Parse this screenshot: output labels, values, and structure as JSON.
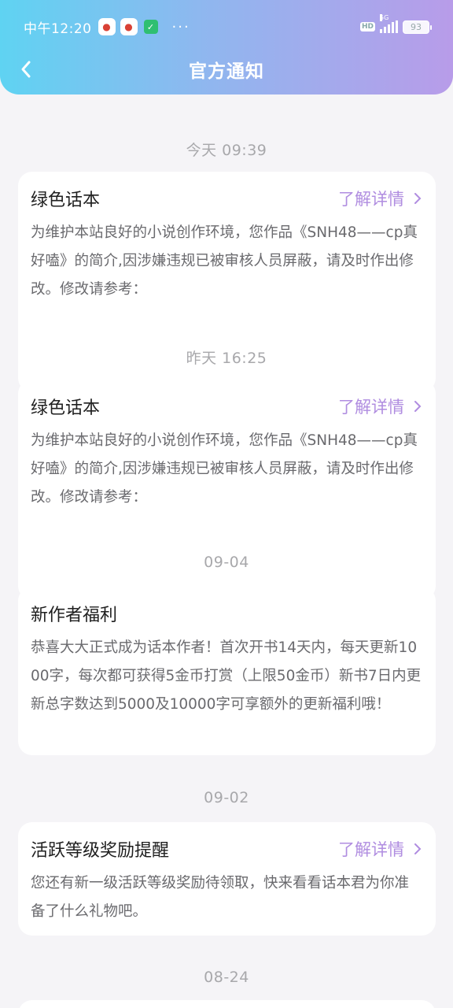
{
  "status_bar": {
    "time": "中午12:20",
    "network": "5G",
    "hd": "HD",
    "battery": "93"
  },
  "nav": {
    "title": "官方通知"
  },
  "notifications": [
    {
      "date": "今天 09:39",
      "title": "绿色话本",
      "link": "了解详情",
      "body": "为维护本站良好的小说创作环境，您作品《SNH48——cp真好嗑》的简介,因涉嫌违规已被审核人员屏蔽，请及时作出修改。修改请参考："
    },
    {
      "date": "昨天 16:25",
      "title": "绿色话本",
      "link": "了解详情",
      "body": "为维护本站良好的小说创作环境，您作品《SNH48——cp真好嗑》的简介,因涉嫌违规已被审核人员屏蔽，请及时作出修改。修改请参考："
    },
    {
      "date": "09-04",
      "title": "新作者福利",
      "link": "",
      "body": "恭喜大大正式成为话本作者！首次开书14天内，每天更新1000字，每次都可获得5金币打赏（上限50金币）新书7日内更新总字数达到5000及10000字可享额外的更新福利哦！"
    },
    {
      "date": "09-02",
      "title": "活跃等级奖励提醒",
      "link": "了解详情",
      "body": "您还有新一级活跃等级奖励待领取，快来看看话本君为你准备了什么礼物吧。"
    },
    {
      "date": "08-24",
      "title": "",
      "link": "",
      "body": ""
    }
  ],
  "colors": {
    "accent": "#b08de0",
    "header_start": "#5fd3f2",
    "header_end": "#b89ce9"
  }
}
